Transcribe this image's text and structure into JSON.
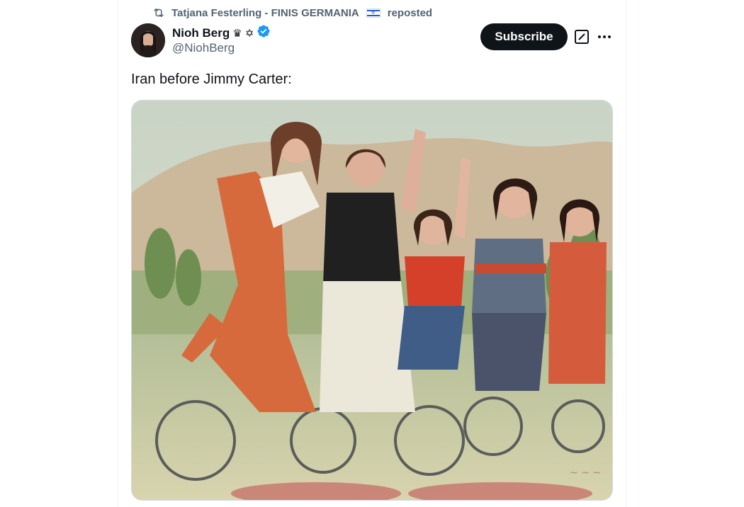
{
  "repost_banner": {
    "text": "Tatjana Festerling - FINIS GERMANIA",
    "suffix": "reposted",
    "icon": "repost-icon",
    "flag_icon": "israel-flag-icon"
  },
  "author": {
    "name": "Nioh Berg",
    "name_emojis": "♛ ✡",
    "handle": "@NiohBerg",
    "verified_icon": "verified-badge-icon",
    "verified_color": "#1d9bf0"
  },
  "actions": {
    "subscribe_label": "Subscribe",
    "grok_icon": "grok-icon",
    "more_icon": "more-icon"
  },
  "tweet": {
    "text": "Iran before Jimmy Carter:"
  },
  "media": {
    "image_icon": "photo-women-bicycles"
  }
}
